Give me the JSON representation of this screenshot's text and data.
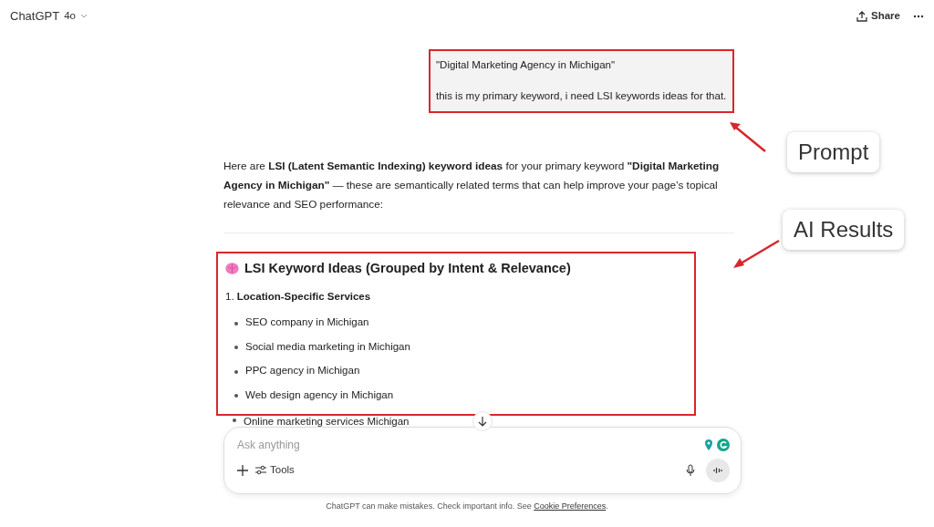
{
  "header": {
    "model_name": "ChatGPT",
    "model_version": "4o",
    "share_label": "Share"
  },
  "prompt": {
    "lines": [
      "\"Digital Marketing Agency in Michigan\"",
      "this is my primary keyword, i need LSI keywords ideas for that."
    ]
  },
  "response": {
    "intro": "Here are **LSI (Latent Semantic Indexing) keyword ideas** for your primary keyword **\"Digital Marketing Agency in Michigan\"** — these are semantically related terms that can help improve your page’s topical relevance and SEO performance:",
    "heading": "LSI Keyword Ideas (Grouped by Intent & Relevance)",
    "section": {
      "number": "1.",
      "title": "Location-Specific Services"
    },
    "items": [
      "SEO company in Michigan",
      "Social media marketing in Michigan",
      "PPC agency in Michigan",
      "Web design agency in Michigan",
      "Online marketing services Michigan"
    ]
  },
  "composer": {
    "placeholder": "Ask anything",
    "tools_label": "Tools"
  },
  "footer": {
    "text": "ChatGPT can make mistakes. Check important info. See",
    "link": "Cookie Preferences",
    "end": "."
  },
  "annotations": [
    {
      "label": "Prompt"
    },
    {
      "label": "AI Results"
    }
  ]
}
